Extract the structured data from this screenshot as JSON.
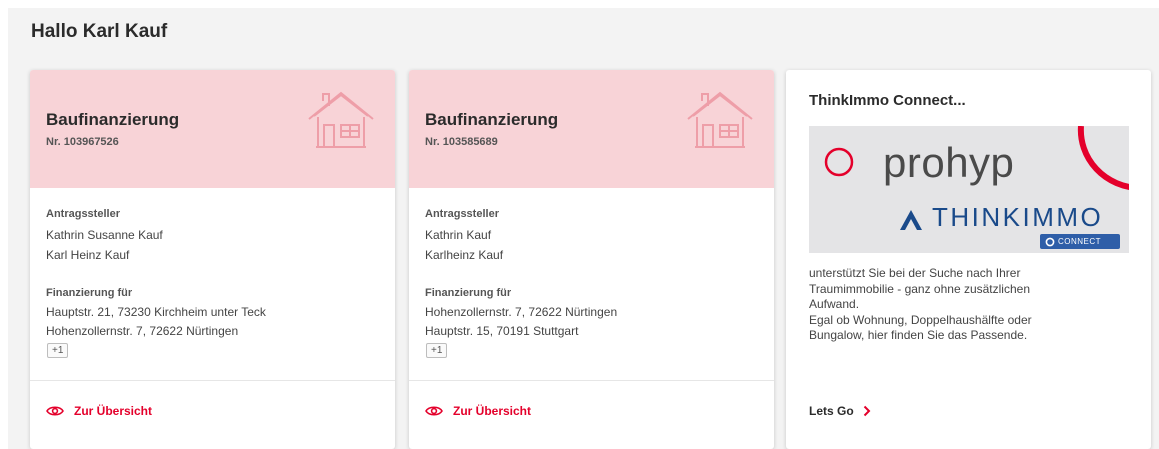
{
  "greeting": "Hallo Karl Kauf",
  "accent_color": "#e4002b",
  "header_bg_color": "#f8d3d7",
  "cards": [
    {
      "title": "Baufinanzierung",
      "number": "Nr. 103967526",
      "icon": "house-icon",
      "applicants_label": "Antragssteller",
      "applicants": [
        "Kathrin Susanne Kauf",
        "Karl Heinz Kauf"
      ],
      "financing_label": "Finanzierung für",
      "addresses": [
        "Hauptstr. 21, 73230 Kirchheim unter Teck",
        "Hohenzollernstr. 7, 72622 Nürtingen"
      ],
      "more": "+1",
      "overview_label": "Zur Übersicht"
    },
    {
      "title": "Baufinanzierung",
      "number": "Nr. 103585689",
      "icon": "house-icon",
      "applicants_label": "Antragssteller",
      "applicants": [
        "Kathrin Kauf",
        "Karlheinz Kauf"
      ],
      "financing_label": "Finanzierung für",
      "addresses": [
        "Hohenzollernstr. 7, 72622 Nürtingen",
        "Hauptstr. 15, 70191 Stuttgart"
      ],
      "more": "+1",
      "overview_label": "Zur Übersicht"
    }
  ],
  "promo": {
    "title": "ThinkImmo Connect...",
    "logo_prohyp": "prohyp",
    "logo_thinkimmo": "THINKIMMO",
    "logo_connect": "CONNECT",
    "text_lines": [
      "unterstützt Sie bei der Suche nach Ihrer",
      "Traumimmobilie - ganz ohne zusätzlichen",
      "Aufwand.",
      "Egal ob Wohnung, Doppelhaushälfte oder",
      "Bungalow, hier finden Sie das Passende."
    ],
    "cta_label": "Lets Go"
  }
}
